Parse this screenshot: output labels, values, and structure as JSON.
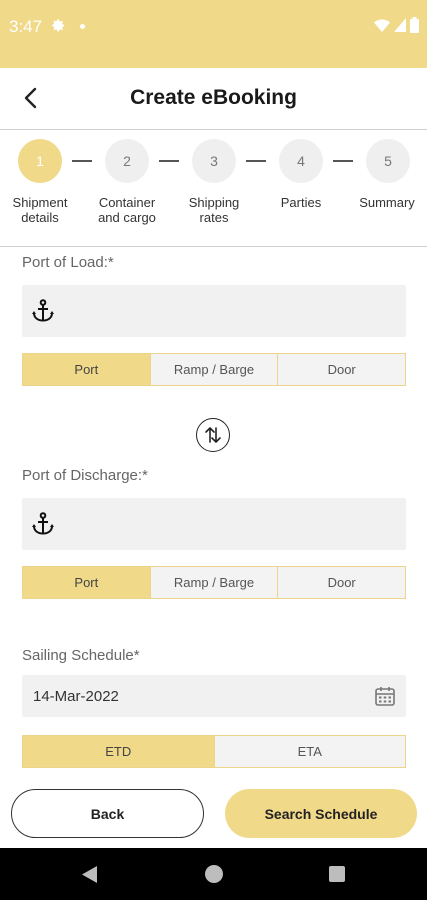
{
  "status_bar": {
    "time": "3:47"
  },
  "app_bar": {
    "title": "Create eBooking"
  },
  "stepper": {
    "steps": [
      {
        "number": "1",
        "label": "Shipment details",
        "active": true
      },
      {
        "number": "2",
        "label": "Container and cargo",
        "active": false
      },
      {
        "number": "3",
        "label": "Shipping rates",
        "active": false
      },
      {
        "number": "4",
        "label": "Parties",
        "active": false
      },
      {
        "number": "5",
        "label": "Summary",
        "active": false
      }
    ]
  },
  "form": {
    "port_of_load": {
      "label": "Port of Load:*",
      "value": "",
      "options": [
        "Port",
        "Ramp / Barge",
        "Door"
      ],
      "selected": "Port"
    },
    "port_of_discharge": {
      "label": "Port of Discharge:*",
      "value": "",
      "options": [
        "Port",
        "Ramp / Barge",
        "Door"
      ],
      "selected": "Port"
    },
    "sailing_schedule": {
      "label": "Sailing Schedule*",
      "value": "14-Mar-2022",
      "options": [
        "ETD",
        "ETA"
      ],
      "selected": "ETD"
    }
  },
  "actions": {
    "back_label": "Back",
    "search_label": "Search Schedule"
  },
  "colors": {
    "accent": "#f1d98a",
    "field_bg": "#f1f1f1",
    "nav_bg": "#000000"
  },
  "icons": [
    "gear-icon",
    "wifi-icon",
    "signal-icon",
    "battery-icon",
    "back-arrow-icon",
    "anchor-icon",
    "swap-icon",
    "calendar-icon"
  ]
}
